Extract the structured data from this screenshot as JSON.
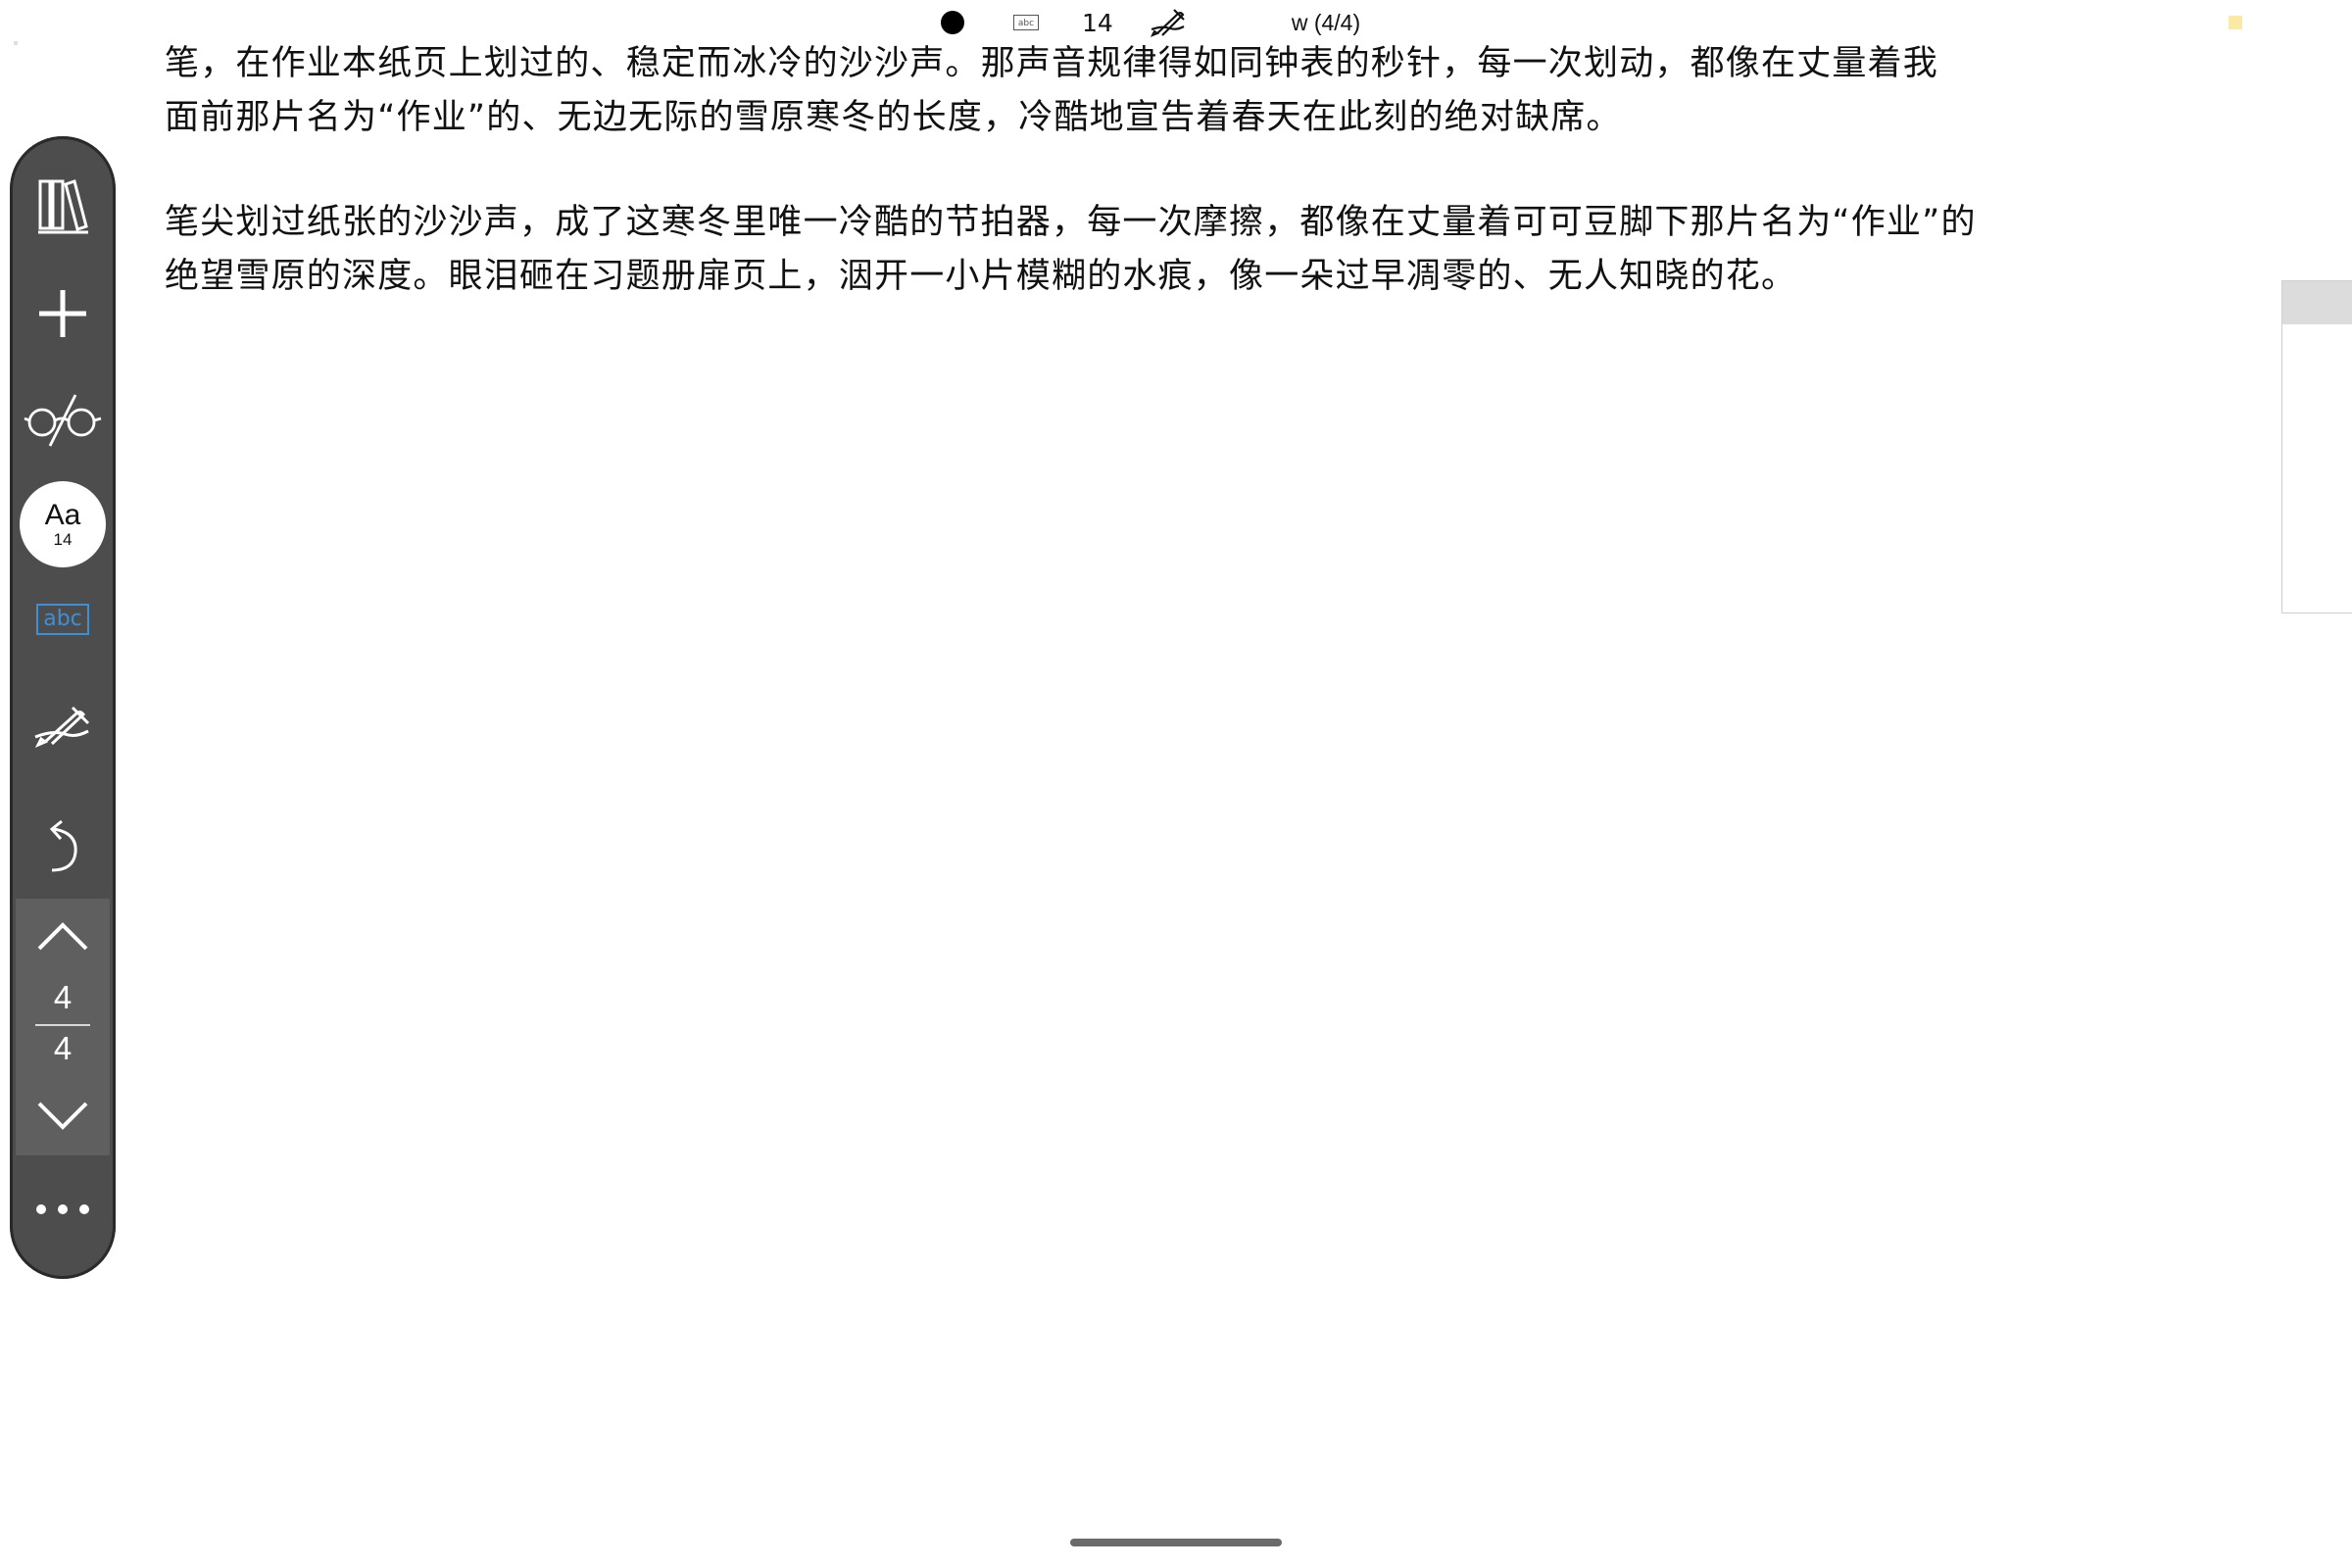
{
  "status_bar": {
    "font_size": "14",
    "page_info": "w (4/4)",
    "icons": [
      "dot-icon",
      "abc-icon",
      "pen-crossed-icon"
    ]
  },
  "content": {
    "paragraphs": [
      "笔，在作业本纸页上划过的、稳定而冰冷的沙沙声。那声音规律得如同钟表的秒针，每一次划动，都像在丈量着我\n面前那片名为“作业”的、无边无际的雪原寒冬的长度，冷酷地宣告着春天在此刻的绝对缺席。",
      "笔尖划过纸张的沙沙声，成了这寒冬里唯一冷酷的节拍器，每一次摩擦，都像在丈量着可可豆脚下那片名为“作业”的\n绝望雪原的深度。眼泪砸在习题册扉页上，洇开一小片模糊的水痕，像一朵过早凋零的、无人知晓的花。"
    ]
  },
  "toolbar": {
    "font_button": {
      "label": "Aa",
      "size": "14"
    },
    "abc_label": "abc",
    "pager": {
      "current": "4",
      "total": "4"
    },
    "icons": [
      "library-icon",
      "plus-icon",
      "glasses-icon",
      "font-size-icon",
      "abc-icon",
      "pen-crossed-icon",
      "undo-icon",
      "chevron-up-icon",
      "chevron-down-icon",
      "more-icon"
    ]
  },
  "colors": {
    "toolbar_bg": "#4d4d4d",
    "pager_bg": "#5f5f5f",
    "accent_blue": "#3d8fd6",
    "corner_marker": "#fbe9a6"
  }
}
